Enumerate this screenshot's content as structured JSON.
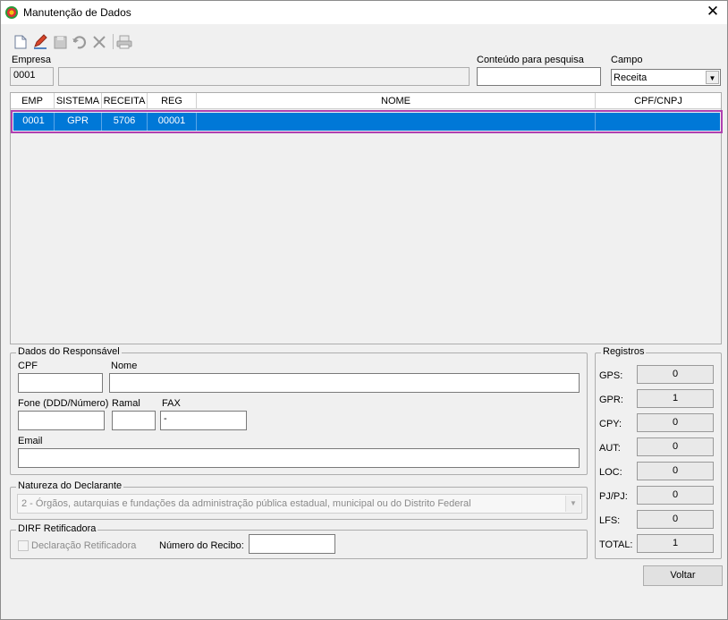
{
  "window": {
    "title": "Manutenção de Dados",
    "close_glyph": "✕"
  },
  "toolbar": {
    "buttons": [
      {
        "name": "new-icon"
      },
      {
        "name": "edit-icon"
      },
      {
        "name": "save-icon"
      },
      {
        "name": "undo-icon"
      },
      {
        "name": "delete-icon"
      },
      {
        "name": "print-icon"
      }
    ]
  },
  "filters": {
    "empresa_label": "Empresa",
    "empresa_value": "0001",
    "empresa_name": "",
    "search_label": "Conteúdo para pesquisa",
    "search_value": "",
    "campo_label": "Campo",
    "campo_value": "Receita",
    "dropdown_glyph": "▼"
  },
  "grid": {
    "columns": [
      "EMP",
      "SISTEMA",
      "RECEITA",
      "REG",
      "NOME",
      "CPF/CNPJ"
    ],
    "rows": [
      [
        "0001",
        "GPR",
        "5706",
        "00001",
        "",
        ""
      ]
    ]
  },
  "responsavel": {
    "title": "Dados do Responsável",
    "cpf_label": "CPF",
    "cpf_value": "",
    "nome_label": "Nome",
    "nome_value": "",
    "fone_label": "Fone (DDD/Número)",
    "fone_value": "",
    "ramal_label": "Ramal",
    "ramal_value": "",
    "fax_label": "FAX",
    "fax_value": "-",
    "email_label": "Email",
    "email_value": ""
  },
  "natureza": {
    "title": "Natureza do Declarante",
    "value": "2 - Órgãos, autarquias e fundações da administração pública estadual, municipal ou do Distrito Federal"
  },
  "dirf": {
    "title": "DIRF Retificadora",
    "checkbox_label": "Declaração Retificadora",
    "checked": false,
    "recibo_label": "Número do Recibo:",
    "recibo_value": ""
  },
  "registros": {
    "title": "Registros",
    "items": [
      {
        "label": "GPS:",
        "value": "0"
      },
      {
        "label": "GPR:",
        "value": "1"
      },
      {
        "label": "CPY:",
        "value": "0"
      },
      {
        "label": "AUT:",
        "value": "0"
      },
      {
        "label": "LOC:",
        "value": "0"
      },
      {
        "label": "PJ/PJ:",
        "value": "0"
      },
      {
        "label": "LFS:",
        "value": "0"
      },
      {
        "label": "TOTAL:",
        "value": "1"
      }
    ]
  },
  "actions": {
    "voltar_label": "Voltar"
  }
}
